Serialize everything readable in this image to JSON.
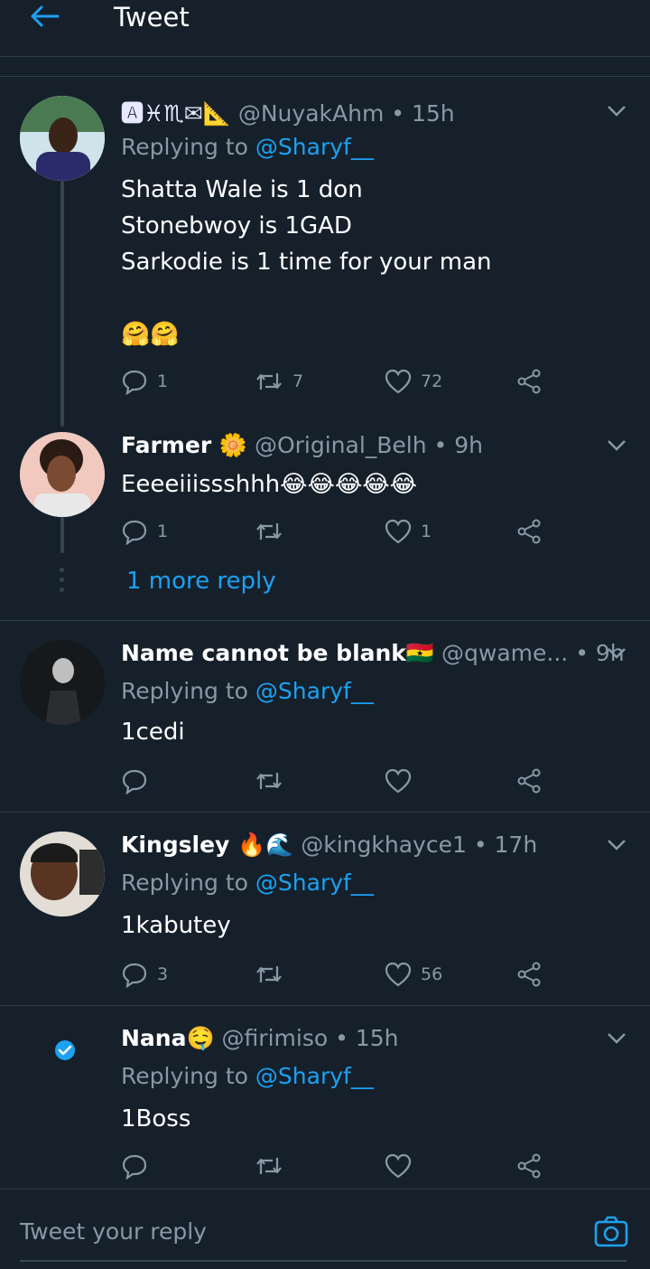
{
  "header": {
    "title": "Tweet"
  },
  "tweets": [
    {
      "name": "🅰♓♏✉📐",
      "handle": "@NuyakAhm",
      "sep": "•",
      "time": "15h",
      "replying_prefix": "Replying to",
      "replying_mention": "@Sharyf__",
      "body": "Shatta Wale is 1 don\nStonebwoy is 1GAD\nSarkodie is 1 time for your man\n\n🤗🤗",
      "replies": "1",
      "retweets": "7",
      "likes": "72"
    },
    {
      "name": "Farmer 🌼",
      "handle": "@Original_Belh",
      "sep": "•",
      "time": "9h",
      "body": "Eeeeiiissshhh😂😂😂😂😂",
      "replies": "1",
      "retweets": "",
      "likes": "1",
      "more_replies": "1 more reply"
    },
    {
      "name": "Name cannot be blank🇬🇭",
      "handle": "@qwame...",
      "sep": "•",
      "time": "9h",
      "replying_prefix": "Replying to",
      "replying_mention": "@Sharyf__",
      "body": "1cedi",
      "replies": "",
      "retweets": "",
      "likes": ""
    },
    {
      "name": "Kingsley 🔥🌊",
      "handle": "@kingkhayce1",
      "sep": "•",
      "time": "17h",
      "replying_prefix": "Replying to",
      "replying_mention": "@Sharyf__",
      "body": "1kabutey",
      "replies": "3",
      "retweets": "",
      "likes": "56"
    },
    {
      "name": "Nana🤤",
      "handle": "@firimiso",
      "sep": "•",
      "time": "15h",
      "replying_prefix": "Replying to",
      "replying_mention": "@Sharyf__",
      "body": "1Boss",
      "replies": "",
      "retweets": "",
      "likes": ""
    }
  ],
  "composer": {
    "placeholder": "Tweet your reply"
  },
  "colors": {
    "background": "#15202b",
    "accent": "#1da1f2",
    "secondary_text": "#8899a6",
    "divider": "#2f3b46"
  },
  "icons": {
    "back": "arrow-left-icon",
    "caret": "chevron-down-icon",
    "reply": "reply-bubble-icon",
    "retweet": "retweet-icon",
    "like": "heart-icon",
    "share": "share-icon",
    "camera": "camera-icon"
  }
}
